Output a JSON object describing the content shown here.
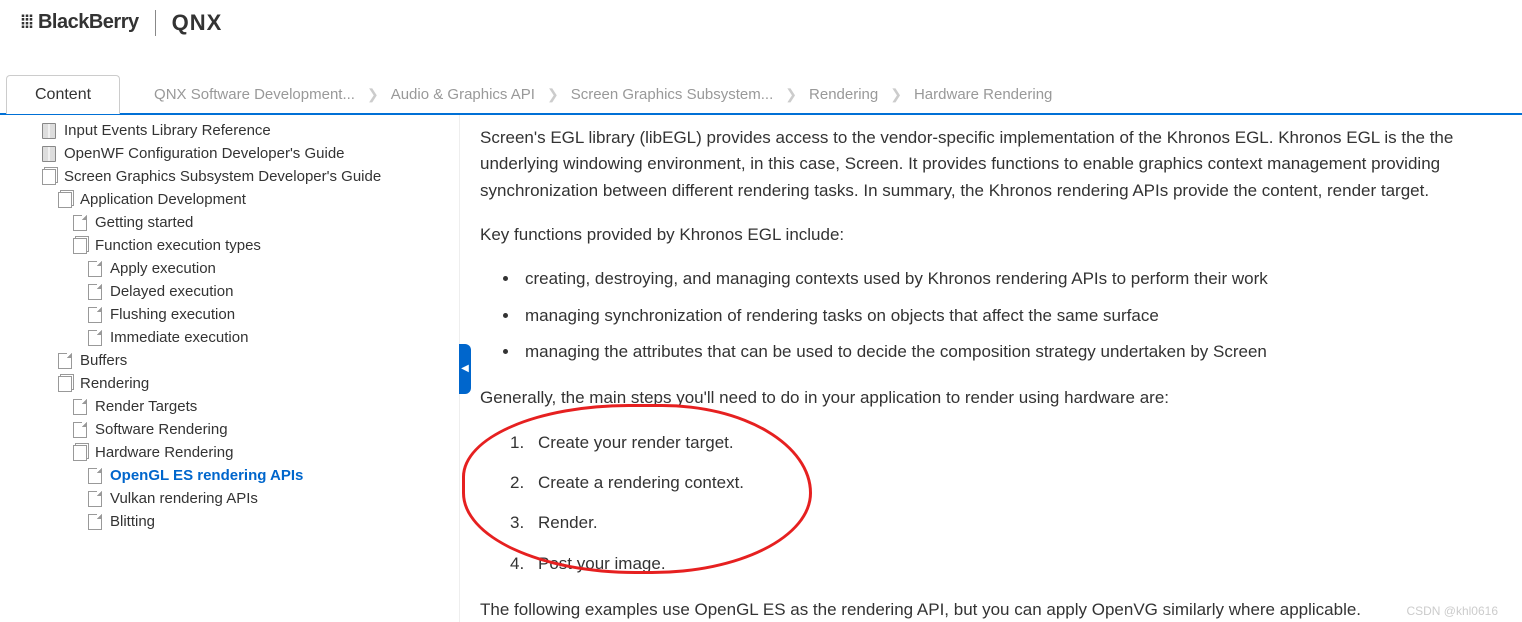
{
  "header": {
    "brand1": "BlackBerry",
    "brand2": "QNX"
  },
  "tab": {
    "label": "Content"
  },
  "breadcrumbs": [
    "QNX Software Development...",
    "Audio & Graphics API",
    "Screen Graphics Subsystem...",
    "Rendering",
    "Hardware Rendering"
  ],
  "tree": [
    {
      "indent": 1,
      "icon": "book",
      "label": "Input Events Library Reference"
    },
    {
      "indent": 1,
      "icon": "book",
      "label": "OpenWF Configuration Developer's Guide"
    },
    {
      "indent": 1,
      "icon": "stack",
      "label": "Screen Graphics Subsystem Developer's Guide"
    },
    {
      "indent": 2,
      "icon": "stack",
      "label": "Application Development"
    },
    {
      "indent": 3,
      "icon": "page",
      "label": "Getting started"
    },
    {
      "indent": 3,
      "icon": "stack",
      "label": "Function execution types"
    },
    {
      "indent": 4,
      "icon": "page",
      "label": "Apply execution"
    },
    {
      "indent": 4,
      "icon": "page",
      "label": "Delayed execution"
    },
    {
      "indent": 4,
      "icon": "page",
      "label": "Flushing execution"
    },
    {
      "indent": 4,
      "icon": "page",
      "label": "Immediate execution"
    },
    {
      "indent": 2,
      "icon": "page",
      "label": "Buffers"
    },
    {
      "indent": 2,
      "icon": "stack",
      "label": "Rendering"
    },
    {
      "indent": 3,
      "icon": "page",
      "label": "Render Targets"
    },
    {
      "indent": 3,
      "icon": "page",
      "label": "Software Rendering"
    },
    {
      "indent": 3,
      "icon": "stack",
      "label": "Hardware Rendering"
    },
    {
      "indent": 4,
      "icon": "page",
      "label": "OpenGL ES rendering APIs",
      "active": true
    },
    {
      "indent": 4,
      "icon": "page",
      "label": "Vulkan rendering APIs"
    },
    {
      "indent": 4,
      "icon": "page",
      "label": "Blitting"
    }
  ],
  "content": {
    "p1": "Screen's EGL library (libEGL) provides access to the vendor-specific implementation of the Khronos EGL. Khronos EGL is the the underlying windowing environment, in this case, Screen. It provides functions to enable graphics context management providing synchronization between different rendering tasks. In summary, the Khronos rendering APIs provide the content, render target.",
    "p2": "Key functions provided by Khronos EGL include:",
    "bullets": [
      "creating, destroying, and managing contexts used by Khronos rendering APIs to perform their work",
      "managing synchronization of rendering tasks on objects that affect the same surface",
      "managing the attributes that can be used to decide the composition strategy undertaken by Screen"
    ],
    "p3": "Generally, the main steps you'll need to do in your application to render using hardware are:",
    "steps": [
      "Create your render target.",
      "Create a rendering context.",
      "Render.",
      "Post your image."
    ],
    "p4": "The following examples use OpenGL ES as the rendering API, but you can apply OpenVG similarly where applicable."
  },
  "watermark": "CSDN @khl0616"
}
